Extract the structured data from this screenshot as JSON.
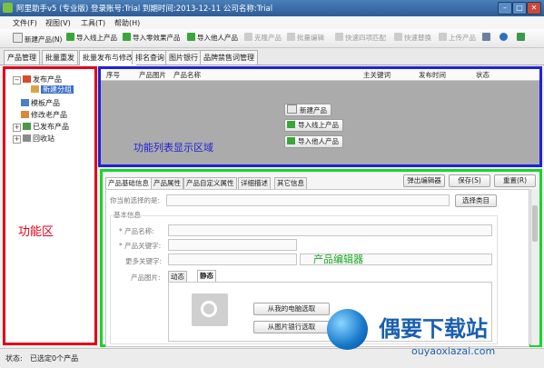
{
  "window": {
    "title": "阿里助手v5 (专业版) 登录账号:Trial  到期时间:2013-12-11    公司名称:Trial"
  },
  "menu": [
    "文件(F)",
    "视图(V)",
    "工具(T)",
    "帮助(H)"
  ],
  "toolbar": {
    "new_product": "新建产品(N)",
    "import_online": "导入线上产品",
    "import_zero": "导入零效果产品",
    "import_others": "导入他人产品",
    "clone": "克隆产品",
    "batch_edit": "批量编辑",
    "quick_match": "快速四项匹配",
    "quick_replace": "快速替换",
    "upload": "上传产品"
  },
  "main_tabs": [
    "产品管理",
    "批量重发",
    "批量发布与修改",
    "排名查询",
    "图片银行",
    "品牌禁售词管理"
  ],
  "tree": {
    "publish": "发布产品",
    "new_group": "新建分组",
    "template": "模板产品",
    "modified_old": "修改老产品",
    "published": "已发布产品",
    "recycle": "回收站"
  },
  "list": {
    "columns": [
      "序号",
      "产品图片",
      "产品名称",
      "主关键词",
      "发布时间",
      "状态"
    ],
    "buttons": {
      "new_product": "新建产品",
      "import_online": "导入线上产品",
      "import_others": "导入他人产品"
    },
    "annotation": "功能列表显示区域"
  },
  "left_annotation": "功能区",
  "editor": {
    "tabs": [
      "产品基础信息",
      "产品属性",
      "产品自定义属性",
      "详细描述",
      "其它信息"
    ],
    "popup_editor": "弹出编辑器",
    "save": "保存(S)",
    "reset": "重置(R)",
    "category_label": "你当前选择的是:",
    "category_button": "选择类目",
    "basic_info": "基本信息",
    "name_label": "产品名称:",
    "keyword_label": "产品关键字:",
    "more_keyword_label": "更多关键字:",
    "image_label": "产品图片:",
    "image_tabs": [
      "动态",
      "静态"
    ],
    "from_computer": "从我的电脑选取",
    "from_bank": "从图片银行选取",
    "annotation": "产品编辑器"
  },
  "status": {
    "label": "状态:",
    "value": "已选定0个产品"
  },
  "watermark": {
    "text": "偶要下载站",
    "url": "ouyaoxiazai.com"
  },
  "colors": {
    "left_border": "#e0001b",
    "list_border": "#1f22d6",
    "editor_border": "#18d42a"
  }
}
